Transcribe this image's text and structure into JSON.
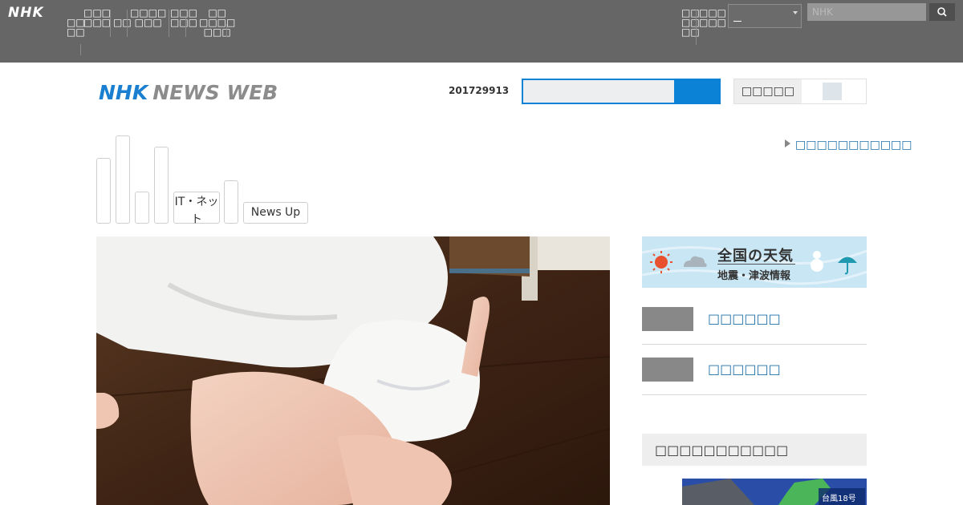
{
  "global_nav": {
    "logo": "NHK",
    "items": [
      "ー",
      "ー",
      "ー",
      "ー",
      "ー",
      "ー",
      "ー",
      "ー"
    ],
    "select_value": "ー",
    "search_placeholder": "NHK"
  },
  "header": {
    "brand_nhk": "NHK",
    "brand_news_web": "NEWS WEB",
    "date_code": "201729913",
    "switch_label": "ー",
    "special_link": "ー"
  },
  "categories": [
    "",
    "",
    "",
    "",
    "IT・ネット",
    "",
    "News Up"
  ],
  "sidebar": {
    "weather_title": "全国の天気",
    "weather_sub": "地震・津波情報",
    "rows": [
      "ー",
      "ー"
    ],
    "box_title": "ー",
    "map_label": "台風18号"
  },
  "colors": {
    "topbar": "#666666",
    "brand_blue": "#1a7fd0",
    "link_blue": "#1b6fa8",
    "search_accent": "#0c82d6"
  }
}
